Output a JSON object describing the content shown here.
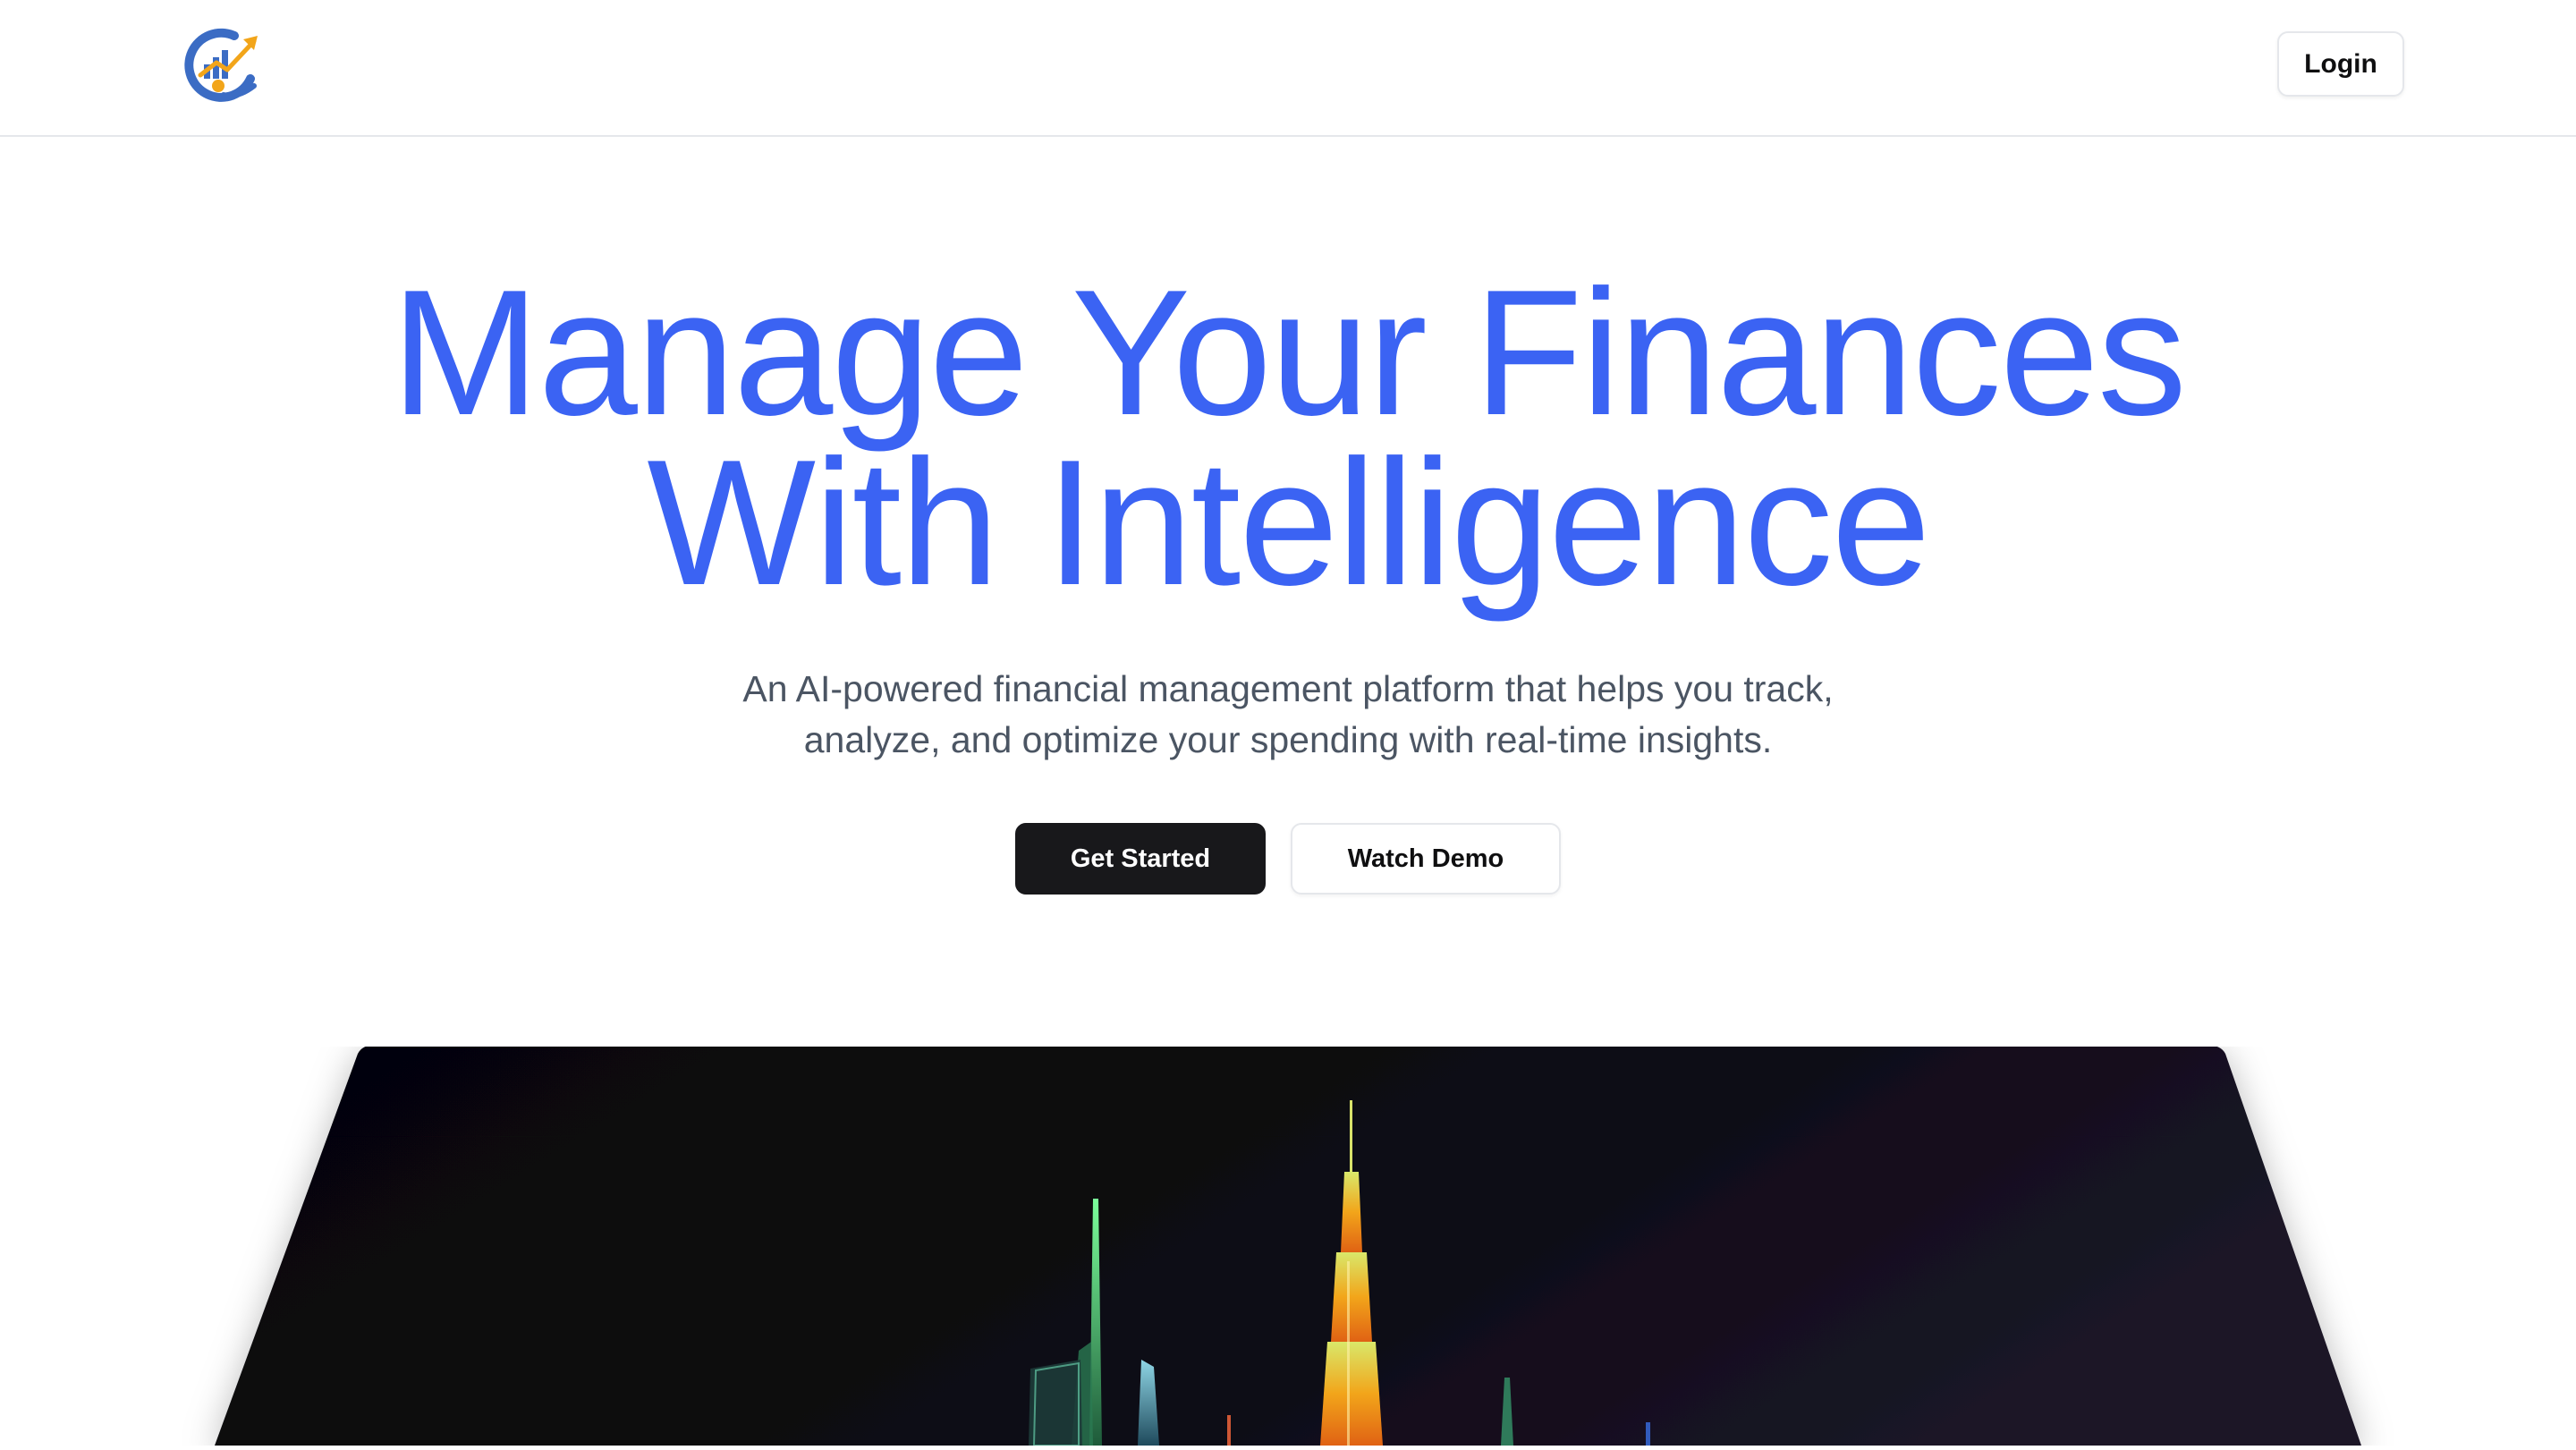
{
  "header": {
    "logo_icon": "finance-logo-icon",
    "login_label": "Login"
  },
  "hero": {
    "title_line1": "Manage Your Finances",
    "title_line2": "With Intelligence",
    "subtitle_line1": "An AI-powered financial management platform that helps you track,",
    "subtitle_line2": "analyze, and optimize your spending with real-time insights.",
    "primary_cta": "Get Started",
    "secondary_cta": "Watch Demo"
  },
  "preview": {
    "image_icon": "city-skyline-illustration"
  },
  "colors": {
    "accent": "#3b63f3",
    "primary_button": "#18181b",
    "subtitle_text": "#4b5563",
    "border": "#e5e7eb"
  }
}
